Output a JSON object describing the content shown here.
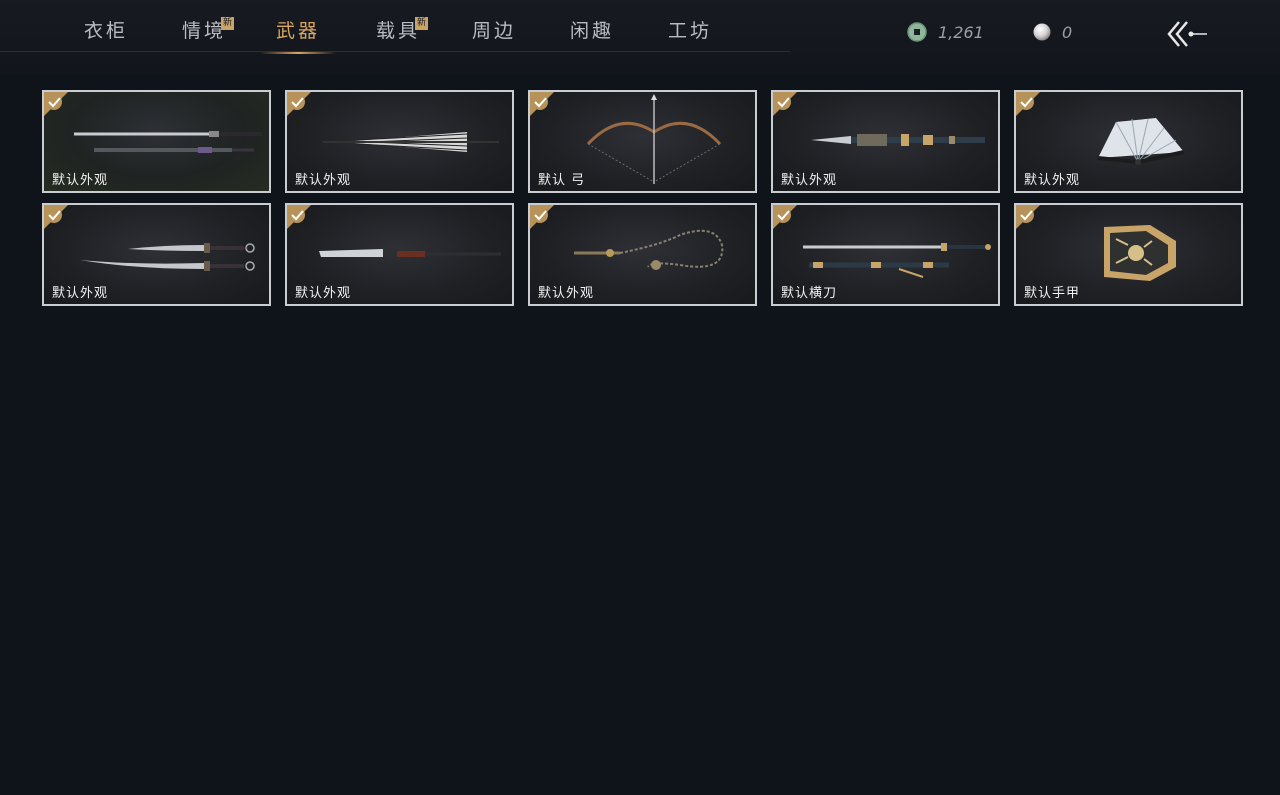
{
  "tabs": [
    {
      "label": "衣柜",
      "is_new": false,
      "active": false
    },
    {
      "label": "情境",
      "is_new": true,
      "active": false
    },
    {
      "label": "武器",
      "is_new": false,
      "active": true
    },
    {
      "label": "载具",
      "is_new": true,
      "active": false
    },
    {
      "label": "周边",
      "is_new": false,
      "active": false
    },
    {
      "label": "闲趣",
      "is_new": false,
      "active": false
    },
    {
      "label": "工坊",
      "is_new": false,
      "active": false
    }
  ],
  "new_badge": "新",
  "currency": {
    "jade_coin": "1,261",
    "pearl": "0"
  },
  "items": [
    {
      "label": "默认外观",
      "icon": "twin-swords-icon",
      "equipped": true
    },
    {
      "label": "默认外观",
      "icon": "umbrella-icon",
      "equipped": true
    },
    {
      "label": "默认 弓",
      "icon": "bow-icon",
      "equipped": true
    },
    {
      "label": "默认外观",
      "icon": "ornate-spear-icon",
      "equipped": true
    },
    {
      "label": "默认外观",
      "icon": "folding-fan-icon",
      "equipped": true
    },
    {
      "label": "默认外观",
      "icon": "dual-sabres-icon",
      "equipped": true
    },
    {
      "label": "默认外观",
      "icon": "glaive-icon",
      "equipped": true
    },
    {
      "label": "默认外观",
      "icon": "rope-dart-icon",
      "equipped": true
    },
    {
      "label": "默认横刀",
      "icon": "hengdao-sword-icon",
      "equipped": true
    },
    {
      "label": "默认手甲",
      "icon": "gauntlet-icon",
      "equipped": true
    }
  ],
  "colors": {
    "accent_gold": "#d9a760",
    "background": "#0f131a",
    "card_border": "#c9ccd1",
    "check_badge": "#b7935a"
  }
}
